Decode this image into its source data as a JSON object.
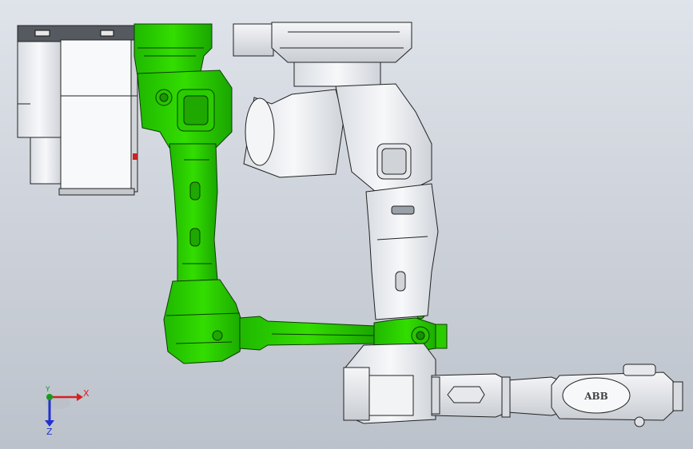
{
  "model": {
    "brand_text": "ABB",
    "highlight_color": "#22cc00",
    "part_color": "#eef0f3",
    "edge_color": "#222222",
    "background_top": "#dfe3ea",
    "background_bottom": "#bcc2cb"
  },
  "triad": {
    "x_label": "X",
    "y_label": "Y",
    "z_label": "Z",
    "x_color": "#d62020",
    "y_color": "#1a9a1a",
    "z_color": "#2030d0"
  }
}
